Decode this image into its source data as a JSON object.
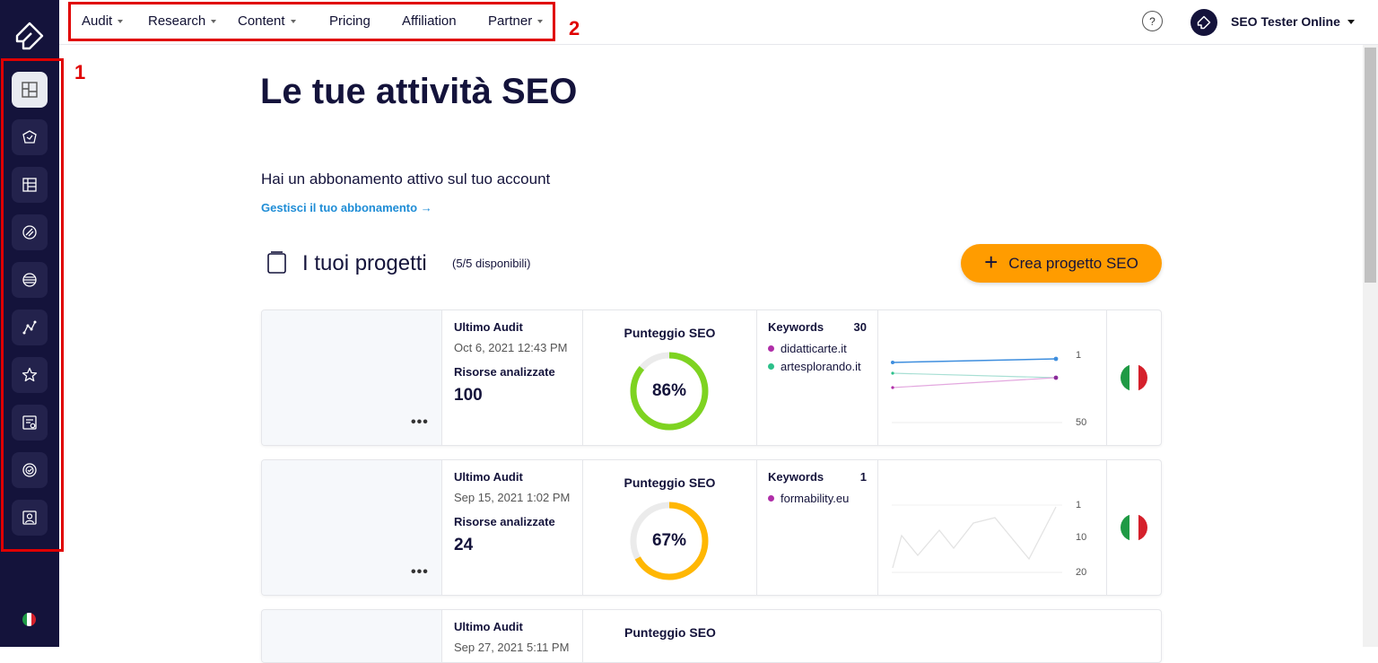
{
  "nav": {
    "items": [
      {
        "label": "Audit",
        "dropdown": true
      },
      {
        "label": "Research",
        "dropdown": true
      },
      {
        "label": "Content",
        "dropdown": true
      },
      {
        "label": "Pricing",
        "dropdown": false
      },
      {
        "label": "Affiliation",
        "dropdown": false
      },
      {
        "label": "Partner",
        "dropdown": true
      }
    ],
    "help_label": "?",
    "user_name": "SEO Tester Online"
  },
  "annotations": {
    "sidebar_marker": "1",
    "nav_marker": "2",
    "color": "#e00000"
  },
  "sidebar": {
    "icons": [
      "dashboard-icon",
      "audit-icon",
      "research-icon",
      "content-icon",
      "globe-icon",
      "analytics-icon",
      "star-icon",
      "report-icon",
      "badge-icon",
      "profile-icon"
    ],
    "language_flag": "italy-flag-icon"
  },
  "page": {
    "title": "Le tue attività SEO",
    "subscription_text": "Hai un abbonamento attivo sul tuo account",
    "manage_link": "Gestisci il tuo abbonamento",
    "projects_title": "I tuoi progetti",
    "projects_count": "(5/5 disponibili)",
    "create_button": "Crea progetto SEO"
  },
  "labels": {
    "last_audit": "Ultimo Audit",
    "resources": "Risorse analizzate",
    "seo_score": "Punteggio SEO",
    "keywords": "Keywords",
    "more": "•••"
  },
  "projects": [
    {
      "date": "Oct 6, 2021 12:43 PM",
      "resources": "100",
      "score": 86,
      "score_text": "86%",
      "score_color": "#7ed321",
      "keyword_count": "30",
      "keywords": [
        {
          "name": "didatticarte.it",
          "color": "#b02ea8"
        },
        {
          "name": "artesplorando.it",
          "color": "#2cc08a"
        }
      ],
      "y_ticks": [
        "1",
        "50"
      ]
    },
    {
      "date": "Sep 15, 2021 1:02 PM",
      "resources": "24",
      "score": 67,
      "score_text": "67%",
      "score_color": "#ffb703",
      "keyword_count": "1",
      "keywords": [
        {
          "name": "formability.eu",
          "color": "#b02ea8"
        }
      ],
      "y_ticks": [
        "1",
        "10",
        "20"
      ]
    },
    {
      "date": "Sep 27, 2021 5:11 PM"
    }
  ],
  "colors": {
    "sidebar_bg": "#14133b",
    "accent_orange": "#ff9c00",
    "link_blue": "#1f8dd6"
  }
}
